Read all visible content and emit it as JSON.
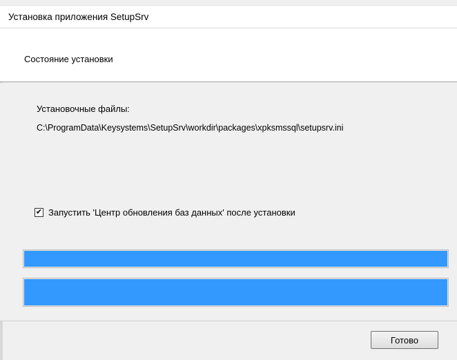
{
  "window": {
    "title": "Установка приложения SetupSrv"
  },
  "header": {
    "text": "Состояние установки"
  },
  "content": {
    "files_label": "Установочные файлы:",
    "files_path": "C:\\ProgramData\\Keysystems\\SetupSrv\\workdir\\packages\\xpksmssql\\setupsrv.ini",
    "checkbox": {
      "checked": true,
      "label": "Запустить 'Центр обновления баз данных' после установки"
    },
    "progress_1": 1.0,
    "progress_2": 1.0,
    "progress_color": "#3399ff"
  },
  "footer": {
    "ok_label": "Готово"
  }
}
